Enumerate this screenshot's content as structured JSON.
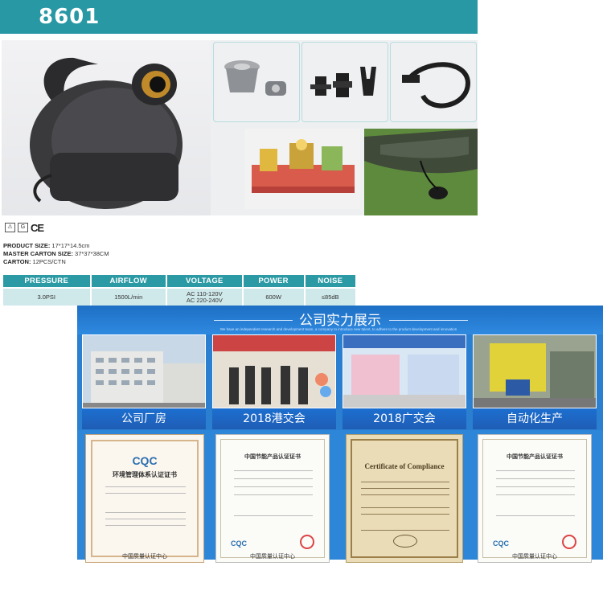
{
  "header": {
    "model": "8601"
  },
  "icons": {
    "mark1": "⚠",
    "mark2": "G",
    "ce": "CE"
  },
  "specs": [
    {
      "label": "PRODUCT SIZE:",
      "value": " 17*17*14.5cm"
    },
    {
      "label": "MASTER CARTON SIZE:",
      "value": " 37*37*38CM"
    },
    {
      "label": "CARTON:",
      "value": " 12PCS/CTN"
    }
  ],
  "table": {
    "headers": [
      "PRESSURE",
      "AIRFLOW",
      "VOLTAGE",
      "POWER",
      "NOISE"
    ],
    "values": [
      "3.0PSI",
      "1500L/min",
      "AC 110-120V",
      "AC 220-240V",
      "600W",
      "≤85dB"
    ]
  },
  "company": {
    "title": "公司实力展示",
    "subtitle": "We have an independent research and development team, a company to introduce new talent, to adhere to the product development and innovation",
    "labels": [
      "公司厂房",
      "2018港交会",
      "2018广交会",
      "自动化生产"
    ]
  },
  "certificates": {
    "c1_title": "环境管理体系认证证书",
    "c1_logo": "CQC",
    "c1_footer": "中国质量认证中心",
    "c2_title": "中国节能产品认证证书",
    "c2_logo": "CQC",
    "c2_footer": "中国质量认证中心",
    "c3_title": "Certificate of Compliance",
    "c4_title": "中国节能产品认证证书",
    "c4_logo": "CQC",
    "c4_footer": "中国质量认证中心"
  }
}
